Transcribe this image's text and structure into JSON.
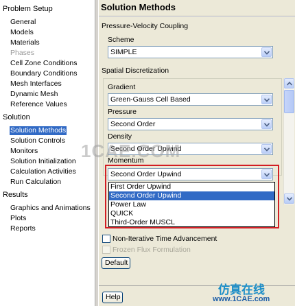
{
  "nav": {
    "groups": [
      {
        "label": "Problem Setup",
        "items": [
          {
            "label": "General"
          },
          {
            "label": "Models"
          },
          {
            "label": "Materials"
          },
          {
            "label": "Phases",
            "disabled": true
          },
          {
            "label": "Cell Zone Conditions"
          },
          {
            "label": "Boundary Conditions"
          },
          {
            "label": "Mesh Interfaces"
          },
          {
            "label": "Dynamic Mesh"
          },
          {
            "label": "Reference Values"
          }
        ]
      },
      {
        "label": "Solution",
        "items": [
          {
            "label": "Solution Methods",
            "selected": true
          },
          {
            "label": "Solution Controls"
          },
          {
            "label": "Monitors"
          },
          {
            "label": "Solution Initialization"
          },
          {
            "label": "Calculation Activities"
          },
          {
            "label": "Run Calculation"
          }
        ]
      },
      {
        "label": "Results",
        "items": [
          {
            "label": "Graphics and Animations"
          },
          {
            "label": "Plots"
          },
          {
            "label": "Reports"
          }
        ]
      }
    ]
  },
  "panel": {
    "title": "Solution Methods",
    "pv_coupling": {
      "section_label": "Pressure-Velocity Coupling",
      "scheme_label": "Scheme",
      "scheme_value": "SIMPLE"
    },
    "spatial": {
      "section_label": "Spatial Discretization",
      "gradient_label": "Gradient",
      "gradient_value": "Green-Gauss Cell Based",
      "pressure_label": "Pressure",
      "pressure_value": "Second Order",
      "density_label": "Density",
      "density_value": "Second Order Upwind",
      "momentum_label": "Momentum",
      "momentum_value": "Second Order Upwind"
    },
    "momentum_options": [
      "First Order Upwind",
      "Second Order Upwind",
      "Power Law",
      "QUICK",
      "Third-Order MUSCL"
    ],
    "momentum_selected_index": 1,
    "non_iterative_label": "Non-Iterative Time Advancement",
    "frozen_flux_label": "Frozen Flux Formulation",
    "default_button": "Default",
    "help_button": "Help"
  },
  "watermark": {
    "center": "1CAE.COM",
    "cn": "仿真在线",
    "url": "www.1CAE.com"
  },
  "colors": {
    "selection": "#316ac5",
    "highlight_border": "#d21e24",
    "panel_bg": "#ece9d8"
  }
}
